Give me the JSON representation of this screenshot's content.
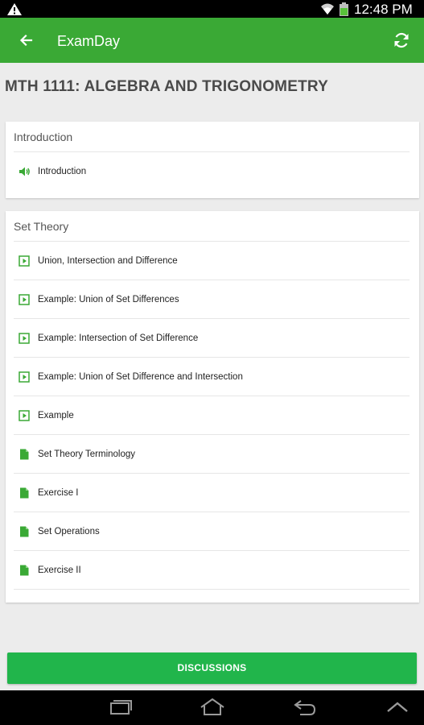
{
  "status_bar": {
    "time": "12:48 PM",
    "icons": [
      "warning-icon",
      "wifi-icon",
      "battery-icon"
    ]
  },
  "app_bar": {
    "title": "ExamDay",
    "back_icon": "arrow-left-icon",
    "refresh_icon": "refresh-icon"
  },
  "course": {
    "title": "MTH 1111: ALGEBRA AND TRIGONOMETRY"
  },
  "sections": [
    {
      "title": "Introduction",
      "items": [
        {
          "label": "Introduction",
          "icon": "audio-icon"
        }
      ]
    },
    {
      "title": "Set Theory",
      "items": [
        {
          "label": "Union, Intersection and Difference",
          "icon": "video-icon"
        },
        {
          "label": "Example: Union of Set Differences",
          "icon": "video-icon"
        },
        {
          "label": "Example: Intersection of Set Difference",
          "icon": "video-icon"
        },
        {
          "label": "Example: Union of Set Difference and Intersection",
          "icon": "video-icon"
        },
        {
          "label": "Example",
          "icon": "video-icon"
        },
        {
          "label": "Set Theory Terminology",
          "icon": "document-icon"
        },
        {
          "label": "Exercise I",
          "icon": "document-icon"
        },
        {
          "label": "Set Operations",
          "icon": "document-icon"
        },
        {
          "label": "Exercise II",
          "icon": "document-icon"
        }
      ]
    }
  ],
  "actions": {
    "discussions_label": "DISCUSSIONS"
  },
  "nav_bar": {
    "icons": [
      "recent-apps-icon",
      "home-icon",
      "back-icon",
      "up-icon"
    ]
  },
  "colors": {
    "app_bar": "#3aa935",
    "accent_green": "#21b54b",
    "icon_green": "#3aa935",
    "background": "#ececec"
  }
}
